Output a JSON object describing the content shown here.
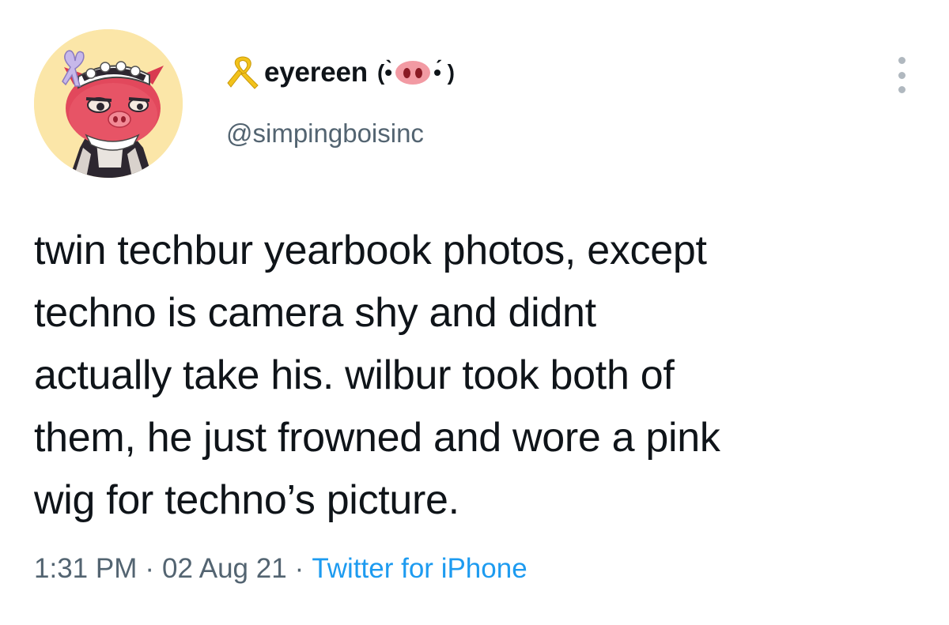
{
  "author": {
    "display_name": "eyereen",
    "kaomoji_left": "(•̀",
    "kaomoji_right": "•́ )",
    "handle": "@simpingboisinc",
    "avatar_icon": "pig-maid-avatar",
    "badge_icon": "yellow-ribbon-icon"
  },
  "tweet": {
    "lines": [
      "twin techbur yearbook photos, except",
      "techno is camera shy and didnt",
      "actually take his. wilbur took both of",
      "them, he just frowned and wore a pink",
      "wig for techno’s picture."
    ]
  },
  "meta": {
    "time": "1:31 PM",
    "separator": "·",
    "date": "02 Aug 21",
    "source": "Twitter for iPhone"
  },
  "colors": {
    "text": "#0f1419",
    "secondary": "#536471",
    "link": "#1d9bf0",
    "avatar_bg": "#fbe6a8",
    "ribbon": "#f2c21b"
  },
  "icons": {
    "more": "more-dots-vertical-icon"
  }
}
